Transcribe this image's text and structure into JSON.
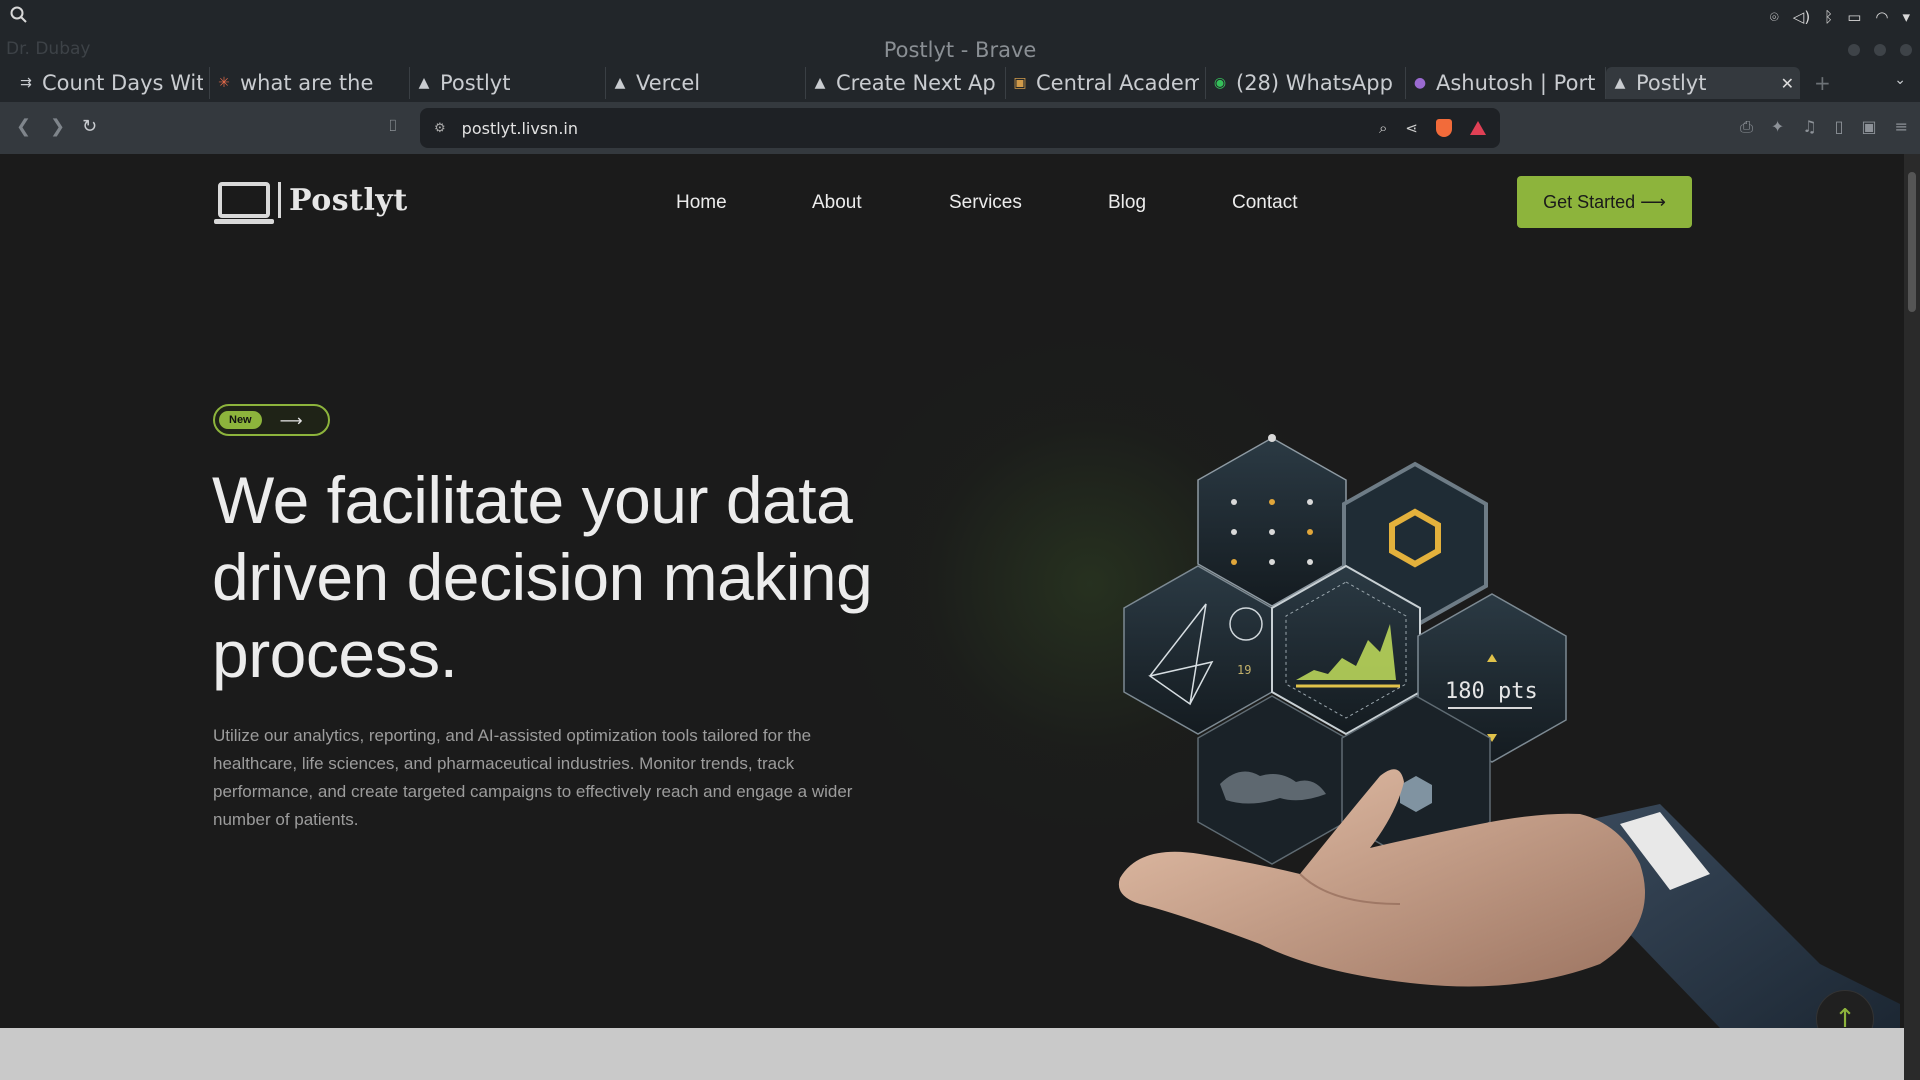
{
  "browser": {
    "window_title": "Postlyt - Brave",
    "ghost_tab_title": "Dr. Dubay",
    "tabs": [
      {
        "label": "Count Days Wit",
        "icon": "counter-icon"
      },
      {
        "label": "what are the",
        "icon": "chat-icon"
      },
      {
        "label": "Postlyt",
        "icon": "vercel-icon"
      },
      {
        "label": "Vercel",
        "icon": "vercel-icon"
      },
      {
        "label": "Create Next Ap",
        "icon": "vercel-icon"
      },
      {
        "label": "Central Academ",
        "icon": "school-icon"
      },
      {
        "label": "(28) WhatsApp",
        "icon": "whatsapp-icon"
      },
      {
        "label": "Ashutosh | Port",
        "icon": "portfolio-icon"
      },
      {
        "label": "Postlyt",
        "icon": "vercel-icon",
        "active": true
      }
    ],
    "url": "postlyt.livsn.in"
  },
  "site": {
    "brand": "Postlyt",
    "nav": [
      "Home",
      "About",
      "Services",
      "Blog",
      "Contact"
    ],
    "cta": "Get Started ⟶",
    "badge": "New",
    "badge_arrow": "⟶",
    "hero_title": "We facilitate your data driven decision making process.",
    "hero_description": "Utilize our analytics, reporting, and AI-assisted optimization tools tailored for the healthcare, life sciences, and pharmaceutical industries. Monitor trends, track performance, and create targeted campaigns to effectively reach and engage a wider number of patients.",
    "art_readout": "180 pts",
    "art_small_readout": "19"
  },
  "colors": {
    "accent": "#8db43c",
    "page_bg": "#1b1b1b",
    "chrome_bg": "#22262a"
  }
}
